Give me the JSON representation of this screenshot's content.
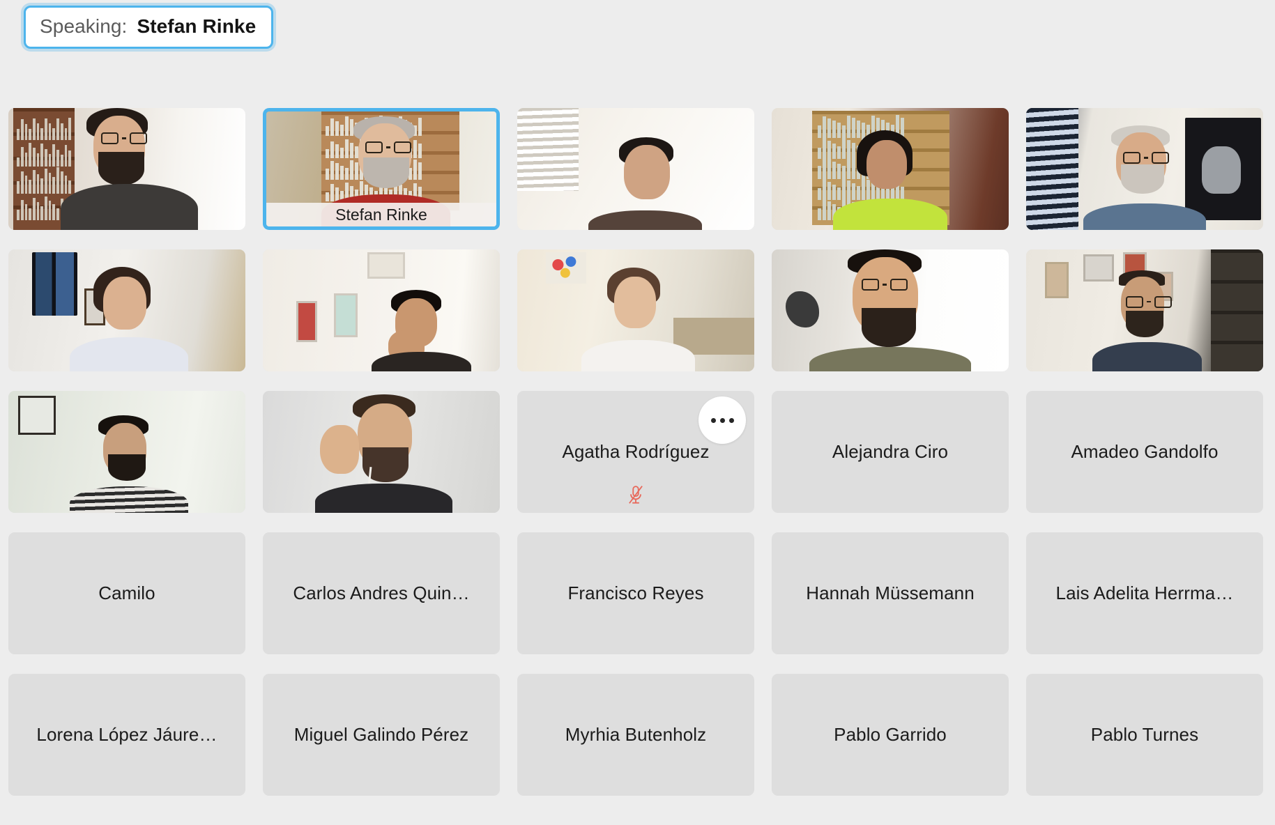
{
  "banner": {
    "label": "Speaking:",
    "name": "Stefan Rinke",
    "accent_color": "#4db4ec"
  },
  "colors": {
    "page_background": "#ededed",
    "tile_background": "#dedede",
    "active_border": "#4db4ec",
    "muted_mic": "#e8685a",
    "text": "#1b1b1b"
  },
  "grid": {
    "columns": 5,
    "rows": 5,
    "tiles": [
      {
        "index": 0,
        "type": "video",
        "active": false,
        "name": "",
        "muted": false,
        "has_menu": false,
        "scene": "t1"
      },
      {
        "index": 1,
        "type": "video",
        "active": true,
        "name": "Stefan Rinke",
        "muted": false,
        "has_menu": false,
        "scene": "t2"
      },
      {
        "index": 2,
        "type": "video",
        "active": false,
        "name": "",
        "muted": false,
        "has_menu": false,
        "scene": "t3"
      },
      {
        "index": 3,
        "type": "video",
        "active": false,
        "name": "",
        "muted": false,
        "has_menu": false,
        "scene": "t4"
      },
      {
        "index": 4,
        "type": "video",
        "active": false,
        "name": "",
        "muted": false,
        "has_menu": false,
        "scene": "t5"
      },
      {
        "index": 5,
        "type": "video",
        "active": false,
        "name": "",
        "muted": false,
        "has_menu": false,
        "scene": "t6"
      },
      {
        "index": 6,
        "type": "video",
        "active": false,
        "name": "",
        "muted": false,
        "has_menu": false,
        "scene": "t7"
      },
      {
        "index": 7,
        "type": "video",
        "active": false,
        "name": "",
        "muted": false,
        "has_menu": false,
        "scene": "t8"
      },
      {
        "index": 8,
        "type": "video",
        "active": false,
        "name": "",
        "muted": false,
        "has_menu": false,
        "scene": "t9"
      },
      {
        "index": 9,
        "type": "video",
        "active": false,
        "name": "",
        "muted": false,
        "has_menu": false,
        "scene": "t10"
      },
      {
        "index": 10,
        "type": "video",
        "active": false,
        "name": "",
        "muted": false,
        "has_menu": false,
        "scene": "t11"
      },
      {
        "index": 11,
        "type": "video",
        "active": false,
        "name": "",
        "muted": false,
        "has_menu": false,
        "scene": "t12"
      },
      {
        "index": 12,
        "type": "placeholder",
        "active": false,
        "name": "Agatha Rodríguez",
        "muted": true,
        "has_menu": true,
        "scene": ""
      },
      {
        "index": 13,
        "type": "placeholder",
        "active": false,
        "name": "Alejandra Ciro",
        "muted": false,
        "has_menu": false,
        "scene": ""
      },
      {
        "index": 14,
        "type": "placeholder",
        "active": false,
        "name": "Amadeo Gandolfo",
        "muted": false,
        "has_menu": false,
        "scene": ""
      },
      {
        "index": 15,
        "type": "placeholder",
        "active": false,
        "name": "Camilo",
        "muted": false,
        "has_menu": false,
        "scene": ""
      },
      {
        "index": 16,
        "type": "placeholder",
        "active": false,
        "name": "Carlos Andres Quin…",
        "muted": false,
        "has_menu": false,
        "scene": ""
      },
      {
        "index": 17,
        "type": "placeholder",
        "active": false,
        "name": "Francisco Reyes",
        "muted": false,
        "has_menu": false,
        "scene": ""
      },
      {
        "index": 18,
        "type": "placeholder",
        "active": false,
        "name": "Hannah Müssemann",
        "muted": false,
        "has_menu": false,
        "scene": ""
      },
      {
        "index": 19,
        "type": "placeholder",
        "active": false,
        "name": "Lais Adelita Herrma…",
        "muted": false,
        "has_menu": false,
        "scene": ""
      },
      {
        "index": 20,
        "type": "placeholder",
        "active": false,
        "name": "Lorena López Jáure…",
        "muted": false,
        "has_menu": false,
        "scene": ""
      },
      {
        "index": 21,
        "type": "placeholder",
        "active": false,
        "name": "Miguel Galindo Pérez",
        "muted": false,
        "has_menu": false,
        "scene": ""
      },
      {
        "index": 22,
        "type": "placeholder",
        "active": false,
        "name": "Myrhia Butenholz",
        "muted": false,
        "has_menu": false,
        "scene": ""
      },
      {
        "index": 23,
        "type": "placeholder",
        "active": false,
        "name": "Pablo Garrido",
        "muted": false,
        "has_menu": false,
        "scene": ""
      },
      {
        "index": 24,
        "type": "placeholder",
        "active": false,
        "name": "Pablo Turnes",
        "muted": false,
        "has_menu": false,
        "scene": ""
      }
    ]
  },
  "icons": {
    "more_menu": "more-options-icon",
    "mic_muted": "microphone-muted-icon"
  }
}
